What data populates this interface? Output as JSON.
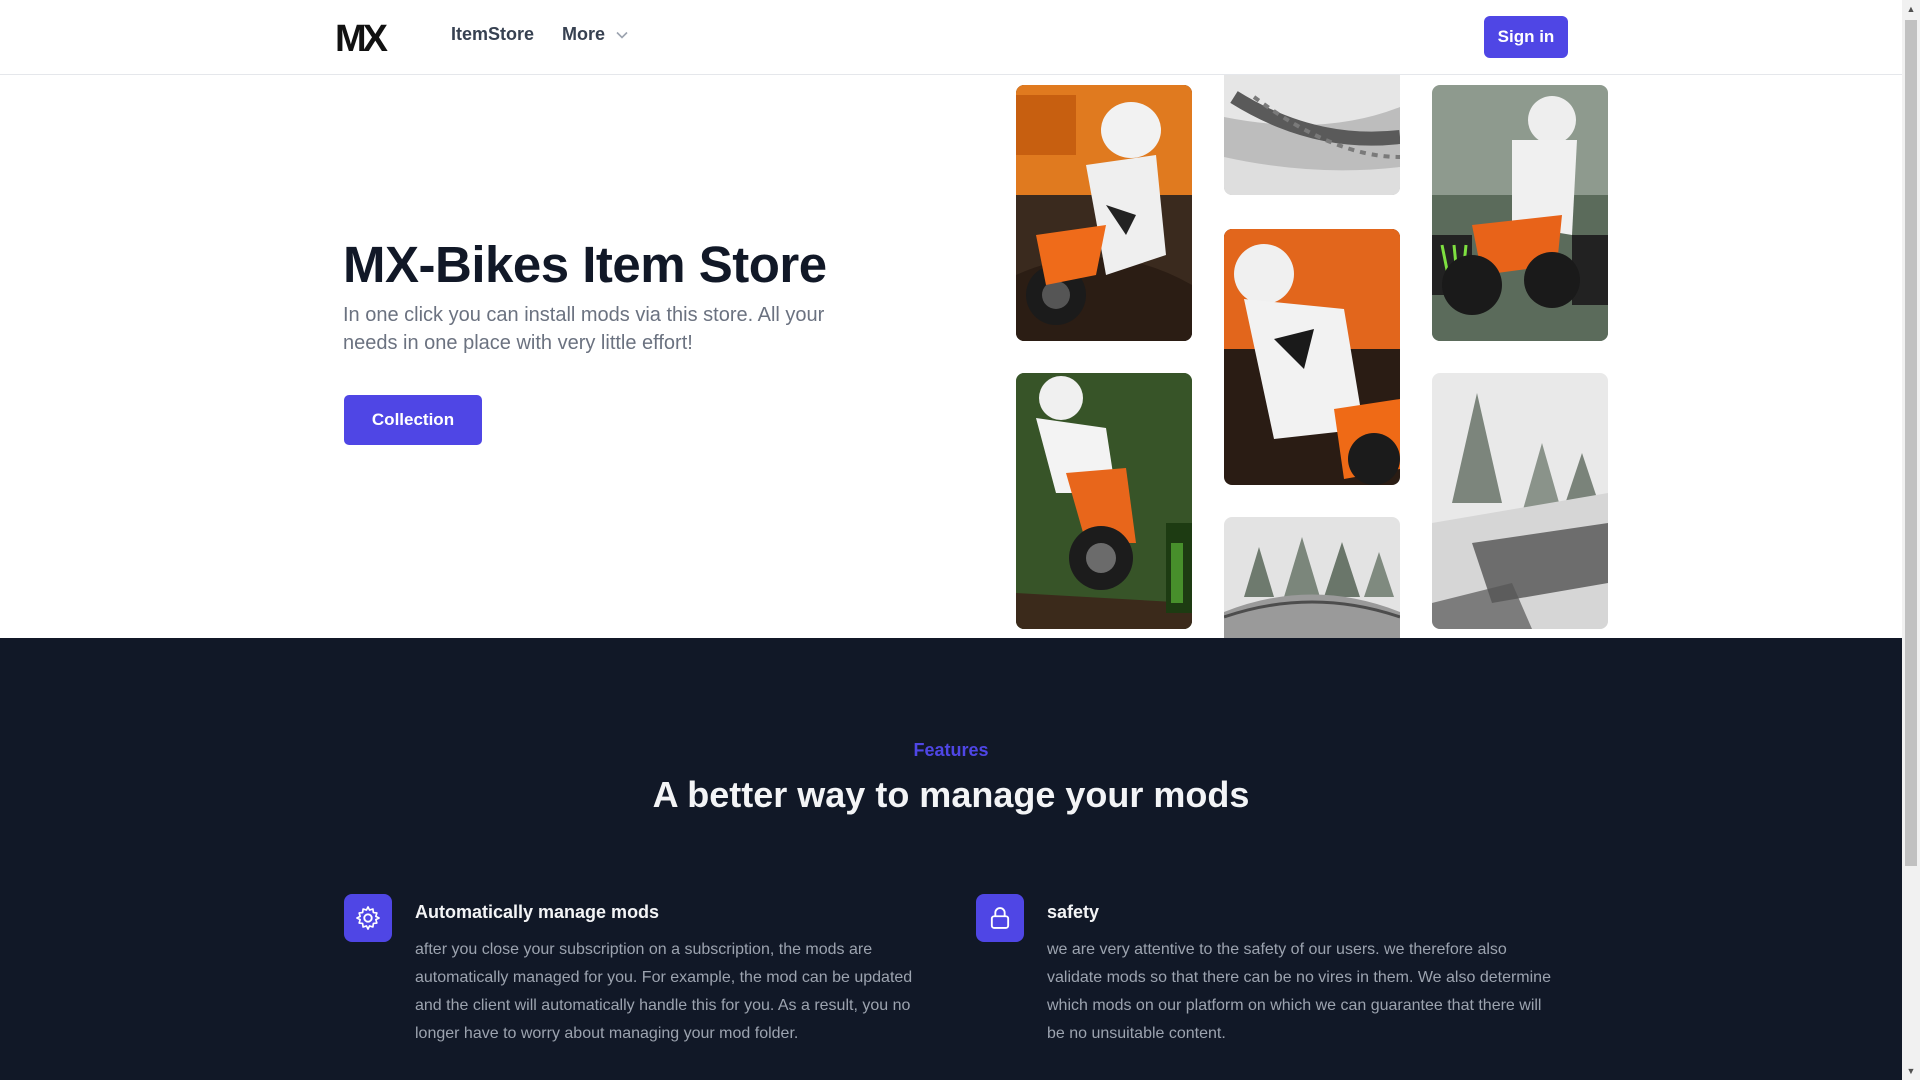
{
  "header": {
    "logo_text": "MX",
    "nav": [
      {
        "label": "ItemStore"
      },
      {
        "label": "More"
      }
    ],
    "signin_label": "Sign in"
  },
  "hero": {
    "title": "MX-Bikes Item Store",
    "subtitle": "In one click you can install mods via this store. All your needs in one place with very little effort!",
    "cta_label": "Collection",
    "images": [
      {
        "name": "rider-ktm-corner"
      },
      {
        "name": "snowy-track-ruts"
      },
      {
        "name": "rider-monster-jump"
      },
      {
        "name": "rider-orange-closeup"
      },
      {
        "name": "rider-forest-jump"
      },
      {
        "name": "snowy-pine-trees"
      },
      {
        "name": "snowy-bridge-trees"
      }
    ]
  },
  "features": {
    "kicker": "Features",
    "title": "A better way to manage your mods",
    "items": [
      {
        "icon": "gear-icon",
        "heading": "Automatically manage mods",
        "text": "after you close your subscription on a subscription, the mods are automatically managed for you. For example, the mod can be updated and the client will automatically handle this for you. As a result, you no longer have to worry about managing your mod folder."
      },
      {
        "icon": "lock-icon",
        "heading": "safety",
        "text": "we are very attentive to the safety of our users. we therefore also validate mods so that there can be no vires in them. We also determine which mods on our platform on which we can guarantee that there will be no unsuitable content."
      }
    ]
  },
  "colors": {
    "accent": "#4f46e5",
    "dark_bg": "#111827"
  }
}
